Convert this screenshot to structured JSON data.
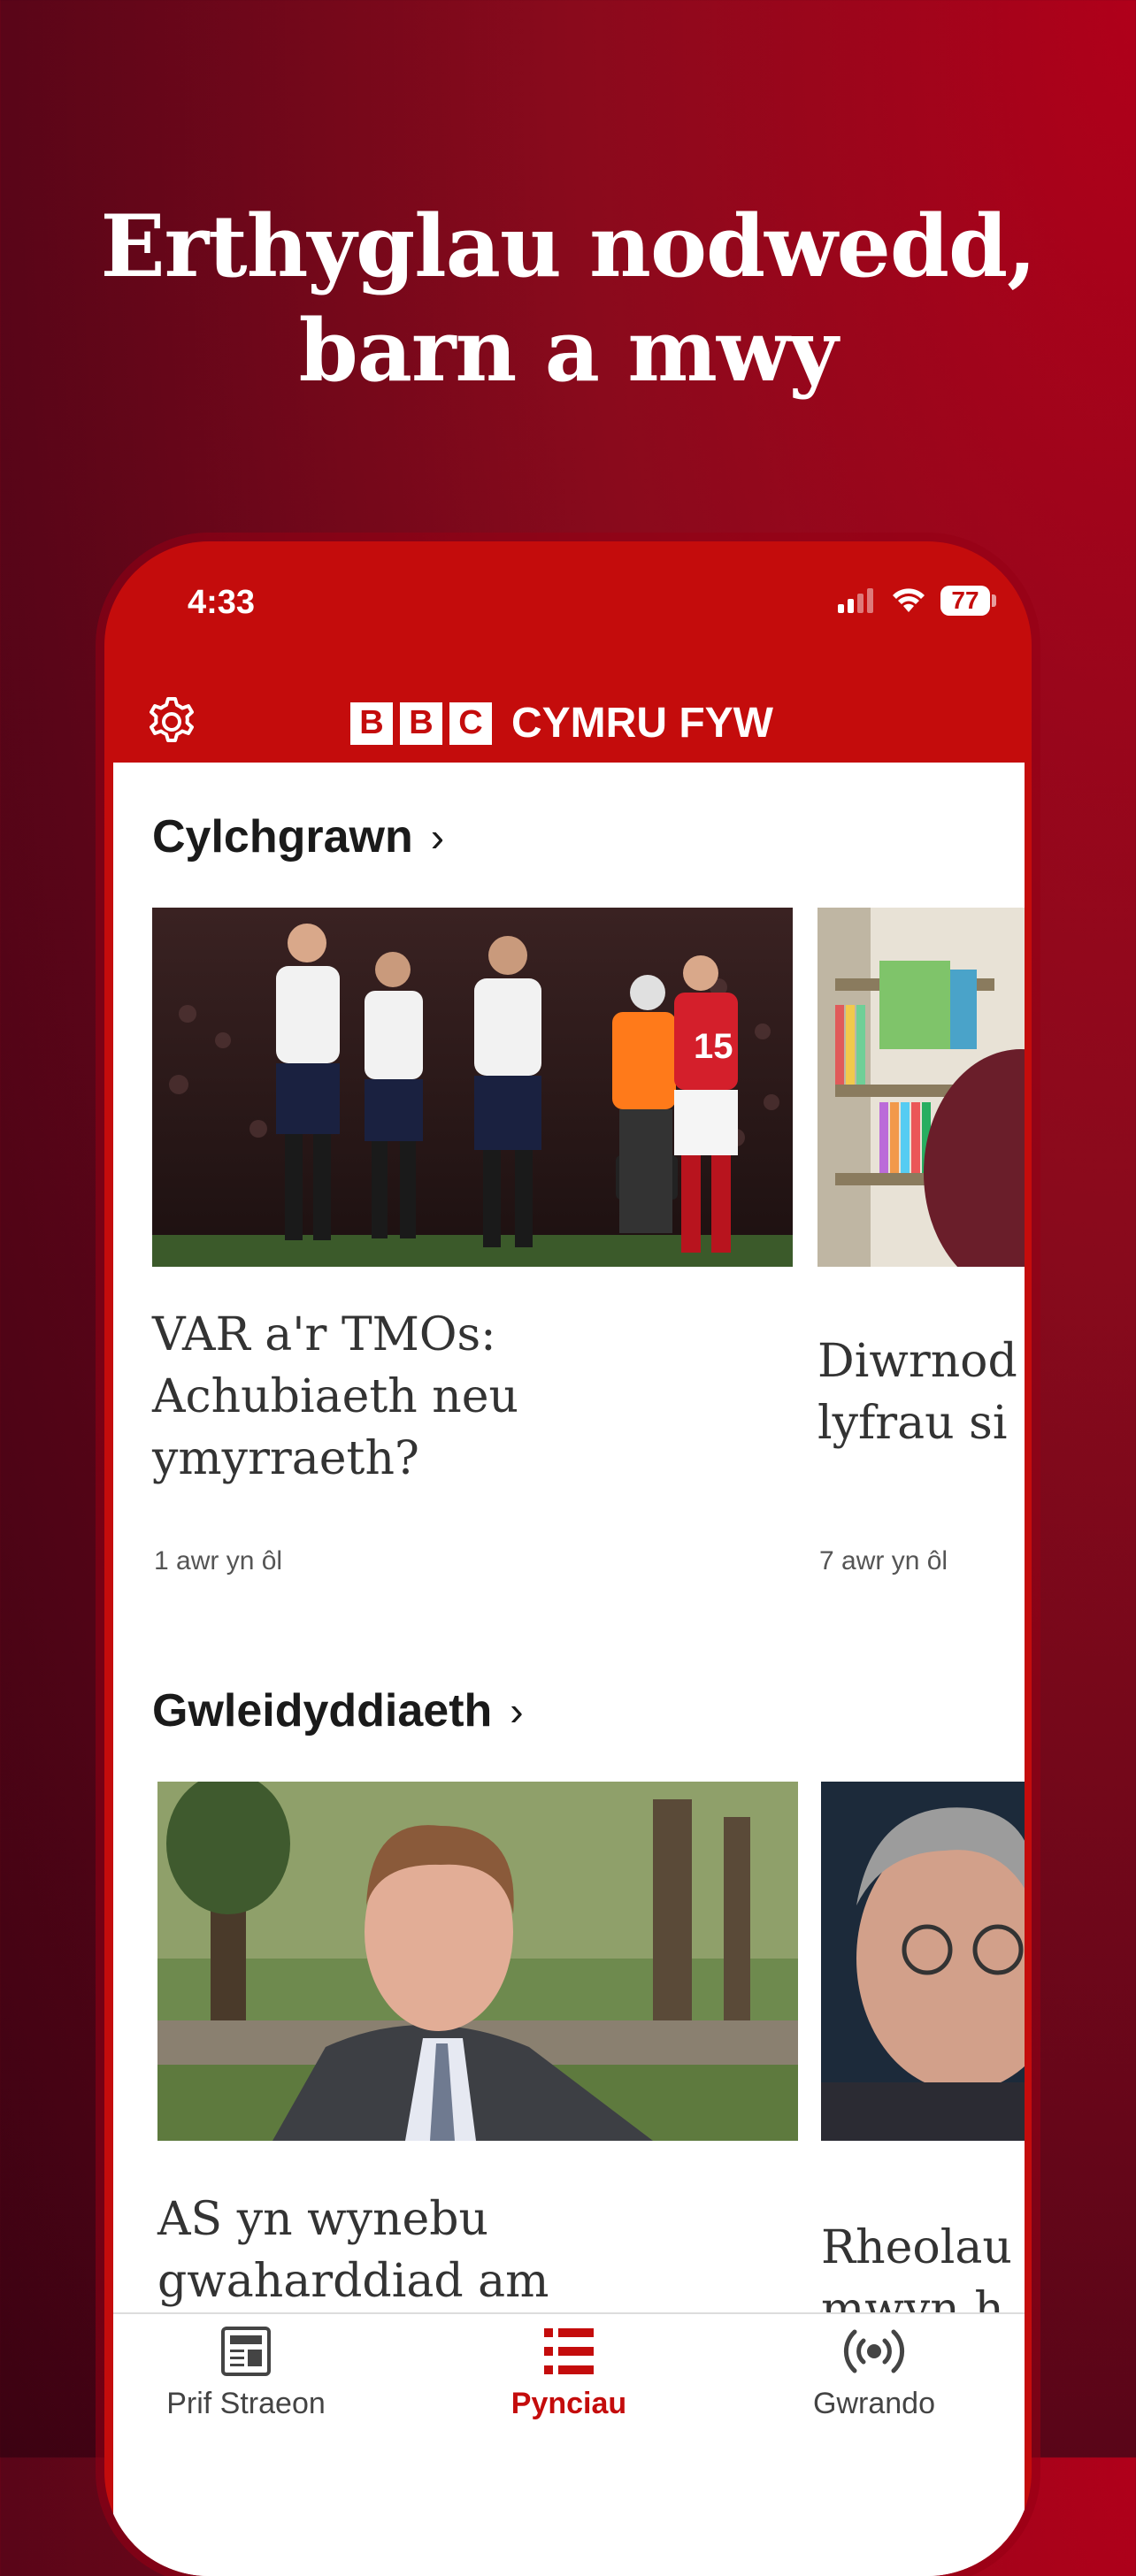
{
  "promo": {
    "line1": "Erthyglau nodwedd,",
    "line2": "barn a mwy"
  },
  "status_bar": {
    "time": "4:33",
    "battery": "77"
  },
  "app_bar": {
    "bbc_letters": [
      "B",
      "B",
      "C"
    ],
    "brand": "CYMRU FYW",
    "settings_icon": "gear-icon"
  },
  "sections": [
    {
      "title": "Cylchgrawn",
      "cards": [
        {
          "title_lines": [
            "VAR a'r TMOs:",
            "Achubiaeth neu",
            "ymyrraeth?"
          ],
          "time": "1 awr yn ôl"
        },
        {
          "title_lines": [
            "Diwrnod",
            "lyfrau si"
          ],
          "time": "7 awr yn ôl"
        }
      ]
    },
    {
      "title": "Gwleidyddiaeth",
      "cards": [
        {
          "title_lines": [
            "AS yn wynebu",
            "gwaharddiad am"
          ],
          "time": ""
        },
        {
          "title_lines": [
            "Rheolau",
            "mwyn h"
          ],
          "time": ""
        }
      ]
    }
  ],
  "tabbar": {
    "tabs": [
      {
        "label": "Prif Straeon",
        "icon": "newspaper-icon"
      },
      {
        "label": "Pynciau",
        "icon": "list-icon",
        "active": true
      },
      {
        "label": "Gwrando",
        "icon": "broadcast-icon"
      }
    ]
  },
  "colors": {
    "brand_red": "#c40c0c",
    "background_dark": "#3c0212"
  }
}
